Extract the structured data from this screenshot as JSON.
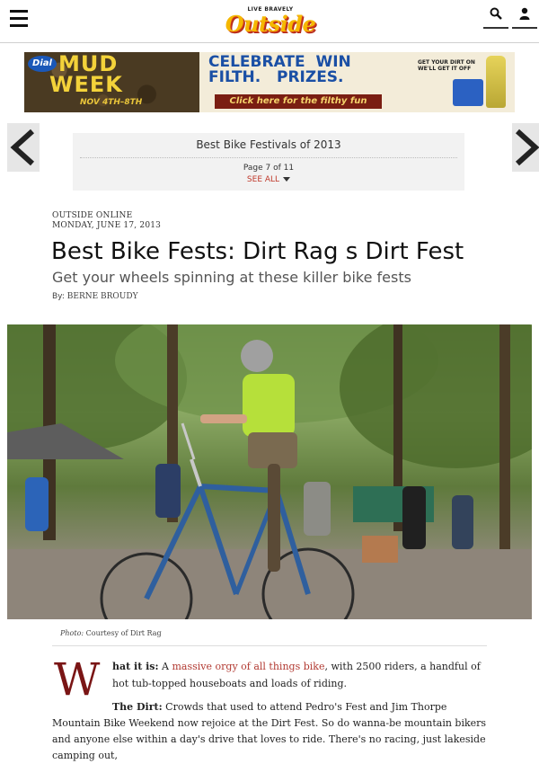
{
  "header": {
    "logo_tagline": "LIVE BRAVELY",
    "logo_word": "Outside",
    "icons": [
      "hamburger-menu-icon",
      "search-icon",
      "user-icon"
    ]
  },
  "ad": {
    "brand": "Dial",
    "mud": "MUD",
    "week": "WEEK",
    "dates": "NOV 4TH–8TH",
    "headline_1": "CELEBRATE  WIN",
    "headline_2": "FILTH.   PRIZES.",
    "cta": "Click here for the filthy fun",
    "side_text": "GET YOUR DIRT ON WE'LL GET IT OFF"
  },
  "slideshow": {
    "title": "Best Bike Festivals of 2013",
    "page_label": "Page 7 of 11",
    "see_all": "SEE ALL",
    "prev_icon": "chevron-left-icon",
    "next_icon": "chevron-right-icon"
  },
  "article": {
    "source": "OUTSIDE ONLINE",
    "date": "MONDAY, JUNE 17, 2013",
    "title": "Best Bike Fests: Dirt Rag s Dirt Fest",
    "subtitle": "Get your wheels spinning at these killer bike fests",
    "byline_prefix": "By:",
    "author": "BERNE BROUDY",
    "photo_label": "Photo:",
    "photo_credit": "Courtesy of Dirt Rag",
    "dropcap": "W",
    "p1_lead": "hat it is:",
    "p1_link": "massive orgy of all things bike",
    "p1_pre": " A ",
    "p1_rest": ", with 2500 riders, a handful of hot tub-topped houseboats and loads of riding.",
    "p2_lead": "The Dirt:",
    "p2_rest": " Crowds that used to attend Pedro's Fest and Jim Thorpe Mountain Bike Weekend now rejoice at the Dirt Fest. So do wanna-be mountain bikers and anyone else within a day's drive that loves to ride. There's no racing, just lakeside camping out,"
  }
}
